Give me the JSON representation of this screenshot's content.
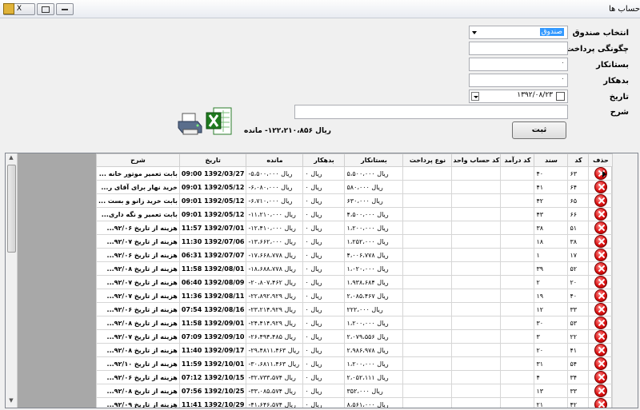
{
  "window": {
    "title": "حساب ها",
    "close_glyph": "X"
  },
  "form": {
    "fund_label": "انتخاب صندوق",
    "fund_value": "صندوق",
    "payment_label": "چگونگی پرداخت",
    "creditor_label": "بستانکار",
    "creditor_value": "۰",
    "debtor_label": "بدهکار",
    "debtor_value": "۰",
    "date_label": "تاریخ",
    "date_value": "۱۳۹۲/۰۸/۲۳",
    "desc_label": "شرح",
    "submit_label": "ثبت",
    "balance_text": "ریال ۱۲۲،۲۱۰،۸۵۶- مانده"
  },
  "table": {
    "columns": [
      "حذف",
      "کد",
      "سند",
      "کد درآمد",
      "کد حساب واحد",
      "نوع پرداخت",
      "بستانکار",
      "بدهکار",
      "مانده",
      "تاریخ",
      "شرح"
    ],
    "rows": [
      [
        "۶۳",
        "۴۰",
        "",
        "",
        "",
        "ریال ۵،۵۰۰،۰۰۰",
        "ریال ۰",
        "ریال ۵،۵۰۰،۰۰۰-",
        "1392/03/27 09:00",
        "بابت تعمیر موتور خانه ..."
      ],
      [
        "۶۴",
        "۴۱",
        "",
        "",
        "",
        "ریال ۵۸۰،۰۰۰",
        "ریال ۰",
        "ریال ۶،۰۸۰،۰۰۰-",
        "1392/05/12 09:01",
        "خرید نهار برای آقای ر..."
      ],
      [
        "۶۵",
        "۴۲",
        "",
        "",
        "",
        "ریال ۶۳۰،۰۰۰",
        "ریال ۰",
        "ریال ۶،۷۱۰،۰۰۰-",
        "1392/05/12 09:01",
        "بابت خرید زانو و بست ..."
      ],
      [
        "۶۶",
        "۴۳",
        "",
        "",
        "",
        "ریال ۴،۵۰۰،۰۰۰",
        "ریال ۰",
        "ریال ۱۱،۲۱۰،۰۰۰-",
        "1392/05/12 09:01",
        "بابت تعمیر و نگه داری..."
      ],
      [
        "۵۱",
        "۳۸",
        "",
        "",
        "",
        "ریال ۱،۲۰۰،۰۰۰",
        "ریال ۰",
        "ریال ۱۲،۴۱۰،۰۰۰-",
        "1392/07/01 11:57",
        "هزینه از تاریخ ۹۲/۰۶..."
      ],
      [
        "۳۸",
        "۱۸",
        "",
        "",
        "",
        "ریال ۱،۲۵۲،۰۰۰",
        "ریال ۰",
        "ریال ۱۳،۶۶۲،۰۰۰-",
        "1392/07/06 11:30",
        "هزینه از تاریخ ۹۲/۰۷..."
      ],
      [
        "۱۷",
        "۱",
        "",
        "",
        "",
        "ریال ۴،۰۰۶،۷۷۸",
        "ریال ۰",
        "ریال ۱۷،۶۶۸،۷۷۸-",
        "1392/07/07 06:31",
        "هزینه از تاریخ ۹۲/۰۶..."
      ],
      [
        "۵۲",
        "۳۹",
        "",
        "",
        "",
        "ریال ۱،۰۲۰،۰۰۰",
        "ریال ۰",
        "ریال ۱۸،۶۸۸،۷۷۸-",
        "1392/08/01 11:58",
        "هزینه از تاریخ ۹۲/۰۸..."
      ],
      [
        "۲۰",
        "۲",
        "",
        "",
        "",
        "ریال ۱،۹۳۸،۶۸۴",
        "ریال ۰",
        "ریال ۲۰،۸۰۷،۴۶۲-",
        "1392/08/09 06:40",
        "هزینه از تاریخ ۹۲/۰۷..."
      ],
      [
        "۴۰",
        "۱۹",
        "",
        "",
        "",
        "ریال ۲،۰۸۵،۴۶۷",
        "ریال ۰",
        "ریال ۲۲،۸۹۲،۹۲۹-",
        "1392/08/11 11:36",
        "هزینه از تاریخ ۹۲/۰۷..."
      ],
      [
        "۳۳",
        "۱۲",
        "",
        "",
        "",
        "ریال ۲۲۲،۰۰۰",
        "ریال ۰",
        "ریال ۲۳،۲۱۴،۹۲۹-",
        "1392/08/16 07:54",
        "هزینه از تاریخ ۹۲/۰۶..."
      ],
      [
        "۵۳",
        "۳۰",
        "",
        "",
        "",
        "ریال ۱،۲۰۰،۰۰۰",
        "ریال ۰",
        "ریال ۲۴،۴۱۴،۹۲۹-",
        "1392/09/01 11:58",
        "هزینه از تاریخ ۹۲/۰۸..."
      ],
      [
        "۲۲",
        "۳",
        "",
        "",
        "",
        "ریال ۲،۰۷۹،۵۵۶",
        "ریال ۰",
        "ریال ۲۶،۴۹۴،۴۸۵-",
        "1392/09/10 07:09",
        "هزینه از تاریخ ۹۲/۰۷..."
      ],
      [
        "۴۱",
        "۲۰",
        "",
        "",
        "",
        "ریال ۲،۹۸۶،۹۷۸",
        "ریال ۰",
        "ریال ۲۹،۴۸۱۱،۴۶۳-",
        "1392/09/17 11:40",
        "هزینه از تاریخ ۹۲/۰۸..."
      ],
      [
        "۵۴",
        "۳۱",
        "",
        "",
        "",
        "ریال ۱،۲۰۰،۰۰۰",
        "ریال ۰",
        "ریال ۳۰،۶۸۱۱،۴۶۳-",
        "1392/10/01 11:59",
        "هزینه از تاریخ ۹۲/۱۰..."
      ],
      [
        "۳۴",
        "۴",
        "",
        "",
        "",
        "ریال ۲،۰۵۲،۱۱۱",
        "ریال ۰",
        "ریال ۳۲،۷۳۳،۵۷۴-",
        "1392/10/15 07:12",
        "هزینه از تاریخ ۹۲/۰۶..."
      ],
      [
        "۳۳",
        "۱۳",
        "",
        "",
        "",
        "ریال ۳۵۲،۰۰۰",
        "ریال ۰",
        "ریال ۳۳،۰۸۵،۵۷۴-",
        "1392/10/25 07:56",
        "هزینه از تاریخ ۹۲/۰۸..."
      ],
      [
        "۴۲",
        "۲۱",
        "",
        "",
        "",
        "ریال ۸،۵۶۱،۰۰۰",
        "ریال ۰",
        "ریال ۴۱،۶۴۶،۵۷۴-",
        "1392/10/29 11:41",
        "هزینه از تاریخ ۹۲/۰۹..."
      ]
    ]
  },
  "icons": {
    "printer": "printer-icon",
    "excel": "excel-icon",
    "delete": "delete-icon"
  }
}
